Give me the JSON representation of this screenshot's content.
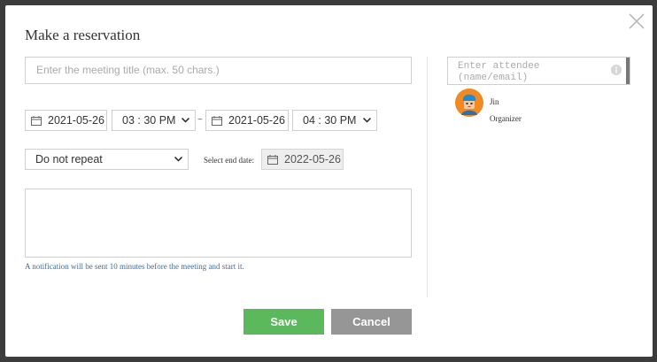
{
  "dialog": {
    "title": "Make a reservation"
  },
  "form": {
    "title_placeholder": "Enter the meeting title (max. 50 chars.)",
    "start_date": "2021-05-26",
    "start_time": "03 : 30 PM",
    "range_separator": "~",
    "end_date": "2021-05-26",
    "end_time": "04 : 30 PM",
    "repeat": "Do not repeat",
    "end_date_label": "Select end date:",
    "repeat_end_date": "2022-05-26",
    "notification": "A notification will be sent 10 minutes before the meeting and start it."
  },
  "attendees": {
    "placeholder": "Enter attendee (name/email)",
    "list": [
      {
        "name": "Jin",
        "role": "Organizer"
      }
    ]
  },
  "actions": {
    "save": "Save",
    "cancel": "Cancel"
  },
  "colors": {
    "save": "#5cb85c",
    "cancel": "#969696",
    "note": "#3b6ea0"
  },
  "icons": [
    "close-icon",
    "calendar-icon",
    "chevron-down-icon",
    "info-icon",
    "avatar"
  ]
}
